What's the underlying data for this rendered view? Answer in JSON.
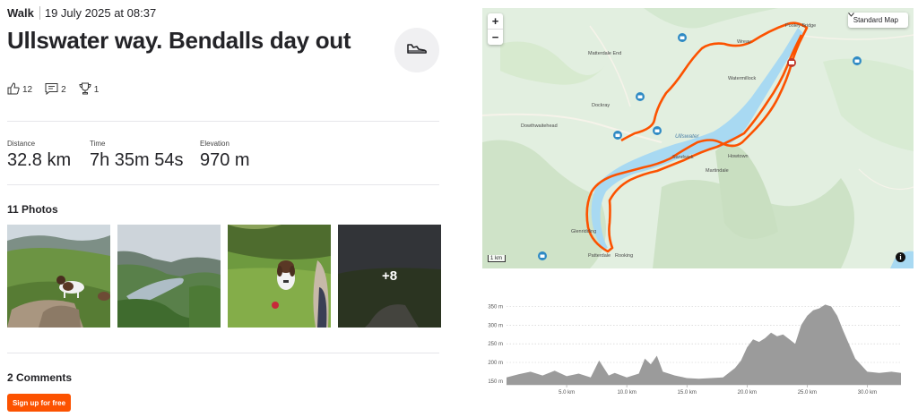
{
  "activity": {
    "type": "Walk",
    "date": "19 July 2025 at 08:37",
    "title": "Ullswater way. Bendalls day out",
    "sport_icon": "shoe-icon"
  },
  "social": {
    "kudos": "12",
    "comments": "2",
    "achievements": "1"
  },
  "stats": [
    {
      "label": "Distance",
      "value": "32.8 km"
    },
    {
      "label": "Time",
      "value": "7h 35m 54s"
    },
    {
      "label": "Elevation",
      "value": "970 m"
    }
  ],
  "photos": {
    "heading": "11 Photos",
    "more": "+8"
  },
  "comments": {
    "heading": "2 Comments"
  },
  "signup_label": "Sign up for free",
  "map": {
    "zoom_in": "+",
    "zoom_out": "−",
    "map_type": "Standard Map",
    "scale": "1 km",
    "info": "i",
    "labels": {
      "pooley_bridge": "Pooley Bridge",
      "watermillock": "Watermillock",
      "matterdale_end": "Matterdale End",
      "dockray": "Dockray",
      "dowthwaitehead": "Dowthwaitehead",
      "ullswater": "Ullswater",
      "sandwick": "Sandwick",
      "howtown": "Howtown",
      "martindale": "Martindale",
      "glenridding": "Glenridding",
      "patterdale": "Patterdale",
      "rooking": "Rooking",
      "wreay": "Wreay"
    },
    "colors": {
      "route": "#fc5200",
      "water": "#a8d9f2",
      "land": "#dfeee0"
    }
  },
  "chart_data": {
    "type": "area",
    "xlabel": "",
    "ylabel": "",
    "x_ticks": [
      "5.0 km",
      "10.0 km",
      "15.0 km",
      "20.0 km",
      "25.0 km",
      "30.0 km"
    ],
    "y_ticks": [
      "150 m",
      "200 m",
      "250 m",
      "300 m",
      "350 m"
    ],
    "ylim": [
      140,
      380
    ],
    "xlim": [
      0,
      32.8
    ],
    "x": [
      0,
      1,
      2,
      3,
      4,
      5,
      6,
      7,
      7.7,
      8.5,
      9,
      10,
      11,
      11.5,
      12,
      12.5,
      13,
      14,
      15,
      16,
      17,
      18,
      19,
      19.5,
      20,
      20.5,
      21,
      21.5,
      22,
      22.5,
      23,
      24,
      24.5,
      25,
      25.5,
      26,
      26.5,
      27,
      27.5,
      28,
      29,
      30,
      31,
      32,
      32.8
    ],
    "y": [
      160,
      168,
      175,
      165,
      178,
      163,
      170,
      160,
      205,
      165,
      172,
      160,
      170,
      210,
      195,
      218,
      175,
      165,
      158,
      156,
      158,
      160,
      185,
      205,
      240,
      262,
      255,
      265,
      280,
      270,
      275,
      250,
      300,
      325,
      340,
      345,
      355,
      350,
      325,
      285,
      210,
      175,
      172,
      175,
      172
    ],
    "grid": true,
    "color": "#9b9b9b"
  }
}
